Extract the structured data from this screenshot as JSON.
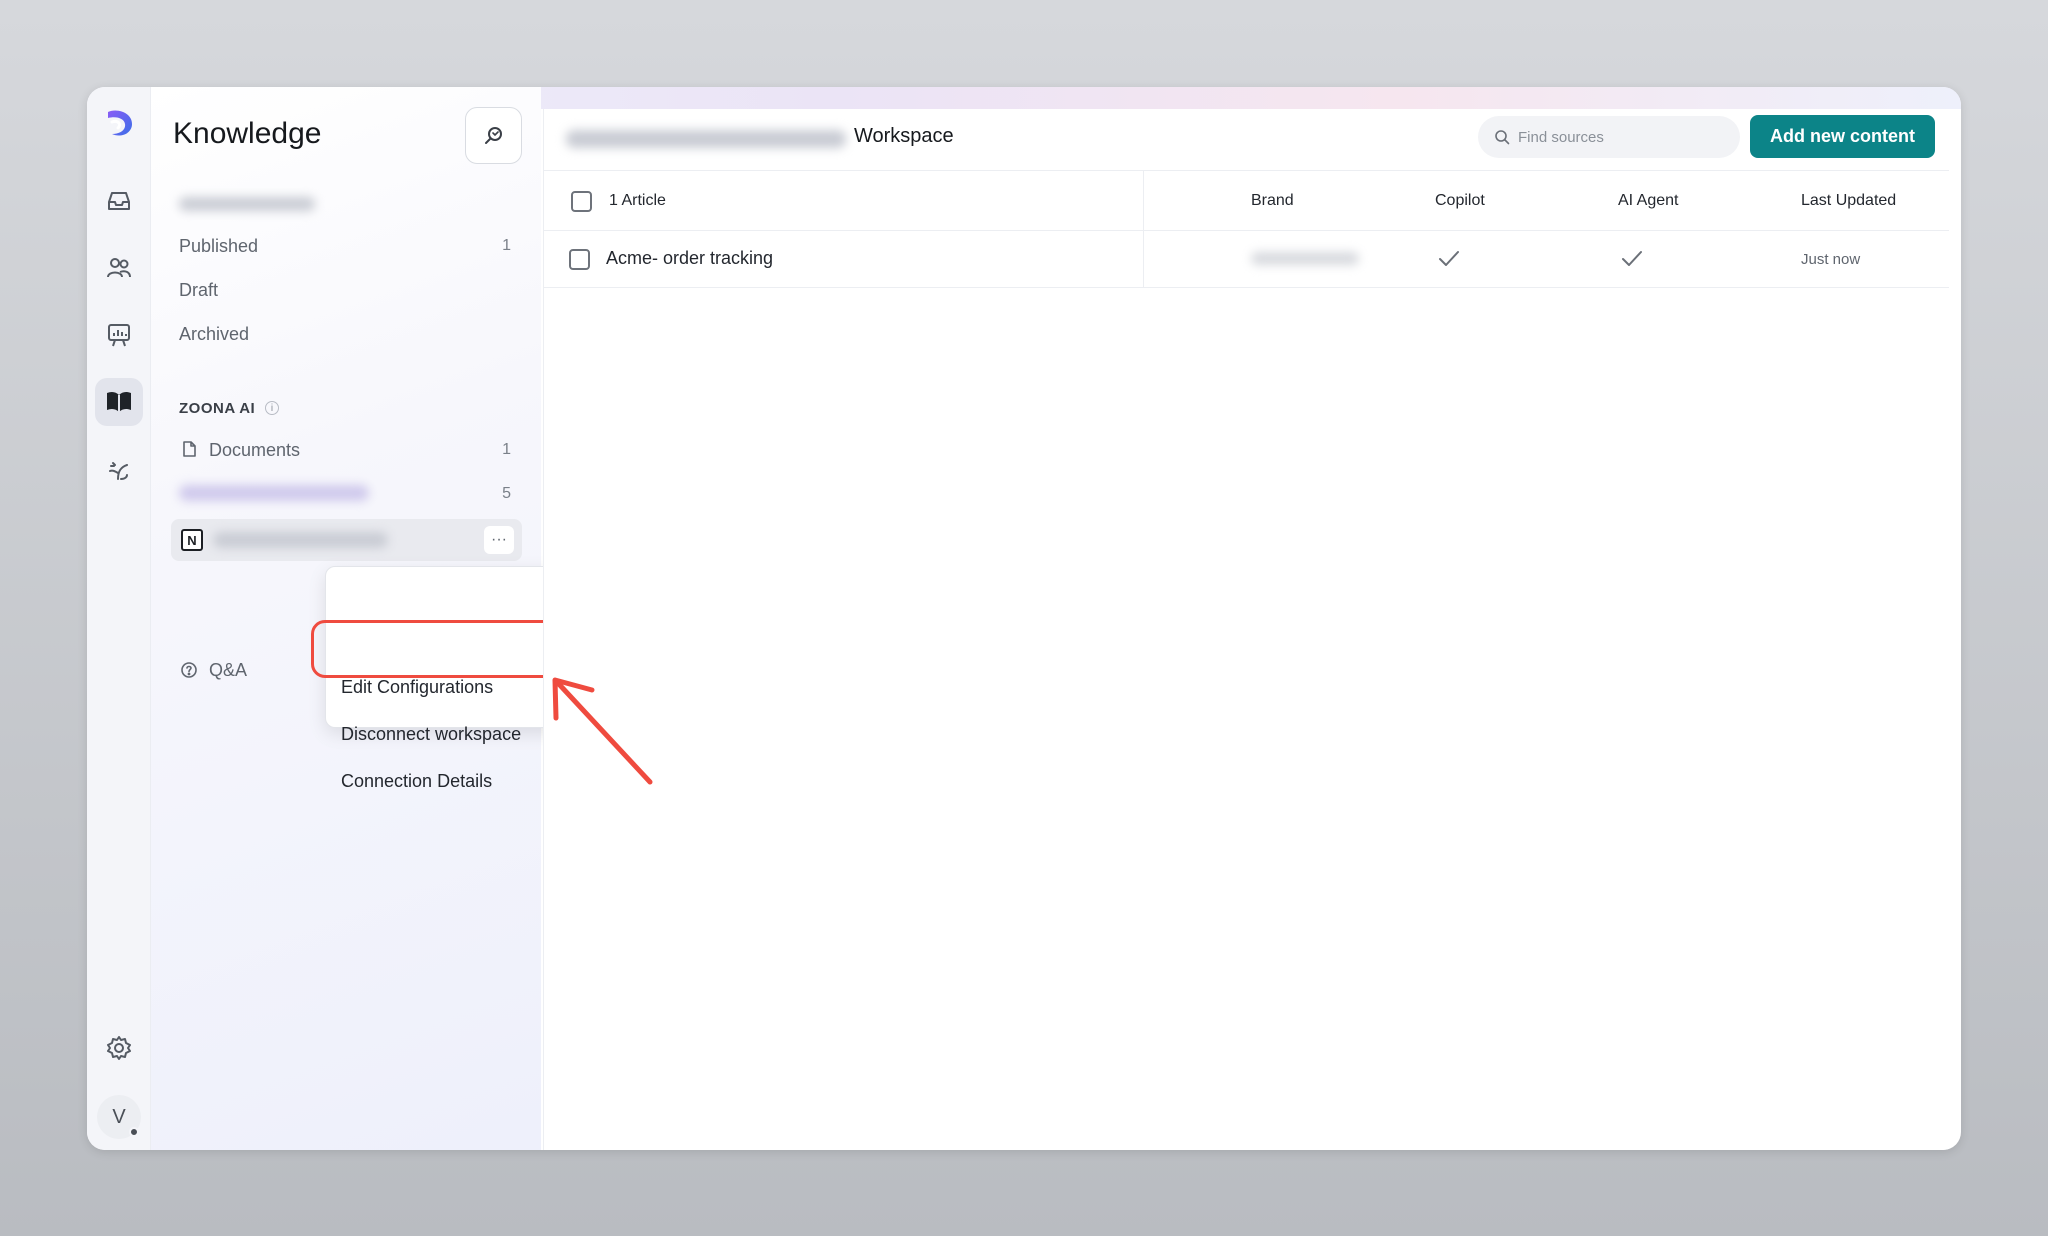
{
  "app": {
    "title": "Knowledge"
  },
  "sidebar": {
    "section_items": [
      {
        "label": "Published",
        "count": "1"
      },
      {
        "label": "Draft",
        "count": ""
      },
      {
        "label": "Archived",
        "count": ""
      }
    ],
    "source_section": "ZOONA AI",
    "sources": [
      {
        "label": "Documents",
        "count": "1"
      },
      {
        "label": "",
        "count": "5"
      }
    ],
    "qa_label": "Q&A",
    "more_label": "···"
  },
  "menu": {
    "items": [
      "Edit Configurations",
      "Disconnect workspace",
      "Connection Details"
    ]
  },
  "header": {
    "title": "Workspace",
    "search_placeholder": "Find sources",
    "add_button": "Add new content"
  },
  "table": {
    "columns": [
      "1 Article",
      "Brand",
      "Copilot",
      "AI Agent",
      "Last Updated"
    ],
    "rows": [
      {
        "title": "Acme- order tracking",
        "copilot": true,
        "ai_agent": true,
        "updated": "Just now"
      }
    ]
  },
  "user": {
    "initial": "V"
  },
  "colors": {
    "accent": "#0c8488",
    "highlight": "#ef4b3f",
    "brand": "#6b4ee6"
  }
}
